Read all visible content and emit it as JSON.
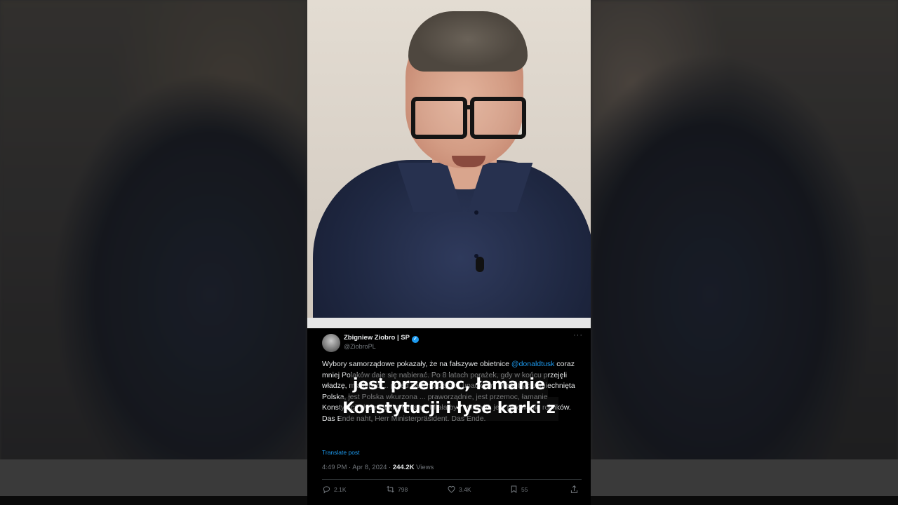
{
  "tweet": {
    "author_name": "Zbigniew Ziobro | SP",
    "verified_mark": "✓",
    "handle": "@ZiobroPL",
    "more": "···",
    "text_before_mention": "Wybory samorządowe pokazały, że na fałszywe obietnice ",
    "mention": "@donaldtusk",
    "text_after_mention": " coraz mniej Polaków daje się nabierać. Po 8 latach porażek, gdy w końcu przejęli władzę, miało być ... przed nadchodzącym upadkiem. Miała być uśmiechnięta Polska, jest Polska wkurzona ... praworządnie, jest przemoc, łamanie Konstytucji i łyse karki z łomami. Miała być wolność, jest pałowanie rolników. Das Ende naht, Herr Ministerpräsident. Das Ende.",
    "translate": "Translate post",
    "time": "4:49 PM · Apr 8, 2024 · ",
    "views_count": "244.2K",
    "views_label": " Views",
    "replies": "2.1K",
    "reposts": "798",
    "likes": "3.4K",
    "bookmarks": "55"
  },
  "caption": {
    "line1": "jest przemoc, łamanie",
    "line2": "Konstytucji i łyse karki z"
  },
  "colors": {
    "link": "#1d9bf0",
    "muted": "#71767b",
    "text": "#e7e9ea",
    "shirt": "#1f2842"
  },
  "icons": [
    "reply-icon",
    "repost-icon",
    "like-icon",
    "bookmark-icon",
    "share-icon",
    "more-icon",
    "verified-icon"
  ]
}
